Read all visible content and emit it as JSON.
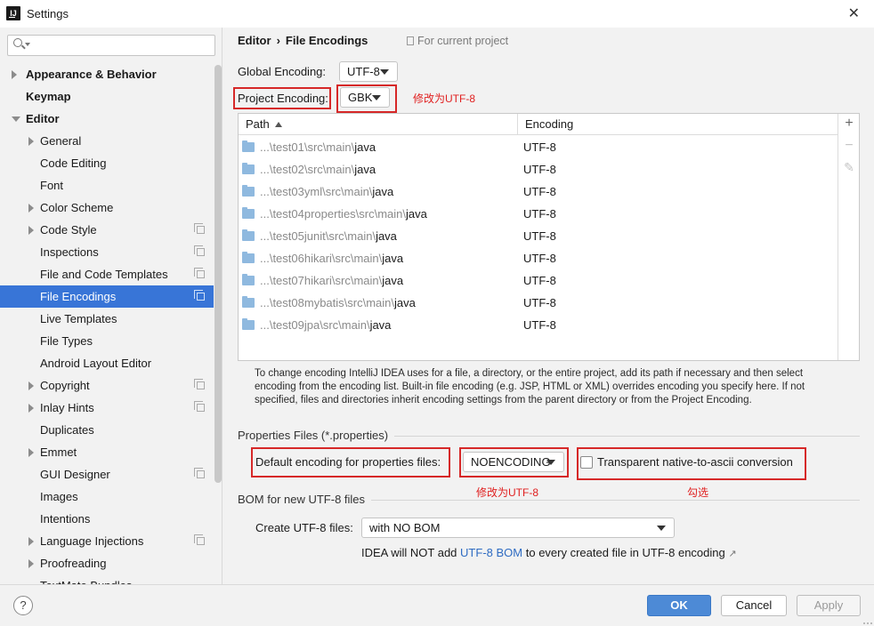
{
  "window": {
    "title": "Settings",
    "app_icon_text": "IJ"
  },
  "sidebar": {
    "search_placeholder": "",
    "items": [
      {
        "label": "Appearance & Behavior",
        "level": 0,
        "arrow": "right",
        "bold": true
      },
      {
        "label": "Keymap",
        "level": 0,
        "arrow": "",
        "bold": true
      },
      {
        "label": "Editor",
        "level": 0,
        "arrow": "down",
        "bold": true
      },
      {
        "label": "General",
        "level": 1,
        "arrow": "right"
      },
      {
        "label": "Code Editing",
        "level": 1,
        "arrow": ""
      },
      {
        "label": "Font",
        "level": 1,
        "arrow": ""
      },
      {
        "label": "Color Scheme",
        "level": 1,
        "arrow": "right"
      },
      {
        "label": "Code Style",
        "level": 1,
        "arrow": "right",
        "copy": true
      },
      {
        "label": "Inspections",
        "level": 1,
        "arrow": "",
        "copy": true
      },
      {
        "label": "File and Code Templates",
        "level": 1,
        "arrow": "",
        "copy": true
      },
      {
        "label": "File Encodings",
        "level": 1,
        "arrow": "",
        "copy": true,
        "selected": true
      },
      {
        "label": "Live Templates",
        "level": 1,
        "arrow": ""
      },
      {
        "label": "File Types",
        "level": 1,
        "arrow": ""
      },
      {
        "label": "Android Layout Editor",
        "level": 1,
        "arrow": ""
      },
      {
        "label": "Copyright",
        "level": 1,
        "arrow": "right",
        "copy": true
      },
      {
        "label": "Inlay Hints",
        "level": 1,
        "arrow": "right",
        "copy": true
      },
      {
        "label": "Duplicates",
        "level": 1,
        "arrow": ""
      },
      {
        "label": "Emmet",
        "level": 1,
        "arrow": "right"
      },
      {
        "label": "GUI Designer",
        "level": 1,
        "arrow": "",
        "copy": true
      },
      {
        "label": "Images",
        "level": 1,
        "arrow": ""
      },
      {
        "label": "Intentions",
        "level": 1,
        "arrow": ""
      },
      {
        "label": "Language Injections",
        "level": 1,
        "arrow": "right",
        "copy": true
      },
      {
        "label": "Proofreading",
        "level": 1,
        "arrow": "right"
      },
      {
        "label": "TextMate Bundles",
        "level": 1,
        "arrow": ""
      }
    ]
  },
  "header": {
    "crumb_parent": "Editor",
    "crumb_sep": "›",
    "crumb_current": "File Encodings",
    "scope_label": "For current project"
  },
  "global_encoding": {
    "label": "Global Encoding:",
    "value": "UTF-8"
  },
  "project_encoding": {
    "label": "Project Encoding:",
    "value": "GBK",
    "annotation": "修改为UTF-8"
  },
  "table": {
    "col_path": "Path",
    "col_encoding": "Encoding",
    "rows": [
      {
        "prefix": "...\\test01\\src\\main\\",
        "last": "java",
        "encoding": "UTF-8"
      },
      {
        "prefix": "...\\test02\\src\\main\\",
        "last": "java",
        "encoding": "UTF-8"
      },
      {
        "prefix": "...\\test03yml\\src\\main\\",
        "last": "java",
        "encoding": "UTF-8"
      },
      {
        "prefix": "...\\test04properties\\src\\main\\",
        "last": "java",
        "encoding": "UTF-8"
      },
      {
        "prefix": "...\\test05junit\\src\\main\\",
        "last": "java",
        "encoding": "UTF-8"
      },
      {
        "prefix": "...\\test06hikari\\src\\main\\",
        "last": "java",
        "encoding": "UTF-8"
      },
      {
        "prefix": "...\\test07hikari\\src\\main\\",
        "last": "java",
        "encoding": "UTF-8"
      },
      {
        "prefix": "...\\test08mybatis\\src\\main\\",
        "last": "java",
        "encoding": "UTF-8"
      },
      {
        "prefix": "...\\test09jpa\\src\\main\\",
        "last": "java",
        "encoding": "UTF-8"
      }
    ],
    "tools": {
      "add": "+",
      "remove": "−",
      "edit": "✎"
    }
  },
  "help_text": "To change encoding IntelliJ IDEA uses for a file, a directory, or the entire project, add its path if necessary and then select encoding from the encoding list. Built-in file encoding (e.g. JSP, HTML or XML) overrides encoding you specify here. If not specified, files and directories inherit encoding settings from the parent directory or from the Project Encoding.",
  "properties": {
    "section_title": "Properties Files (*.properties)",
    "default_label": "Default encoding for properties files:",
    "default_value": "NOENCODING",
    "default_annotation": "修改为UTF-8",
    "transparent_label": "Transparent native-to-ascii conversion",
    "transparent_checked": false,
    "transparent_annotation": "勾选"
  },
  "bom": {
    "section_title": "BOM for new UTF-8 files",
    "create_label": "Create UTF-8 files:",
    "create_value": "with NO BOM",
    "note_before": "IDEA will NOT add",
    "note_link": "UTF-8 BOM",
    "note_after": "to every created file in UTF-8 encoding",
    "note_arrow": "↗"
  },
  "footer": {
    "help": "?",
    "ok": "OK",
    "cancel": "Cancel",
    "apply": "Apply"
  },
  "colors": {
    "selection": "#3875d7",
    "annotation_red": "#d62828",
    "ok_button": "#4d8ad6",
    "link": "#2e6bc2",
    "folder_icon": "#8fb9df"
  }
}
